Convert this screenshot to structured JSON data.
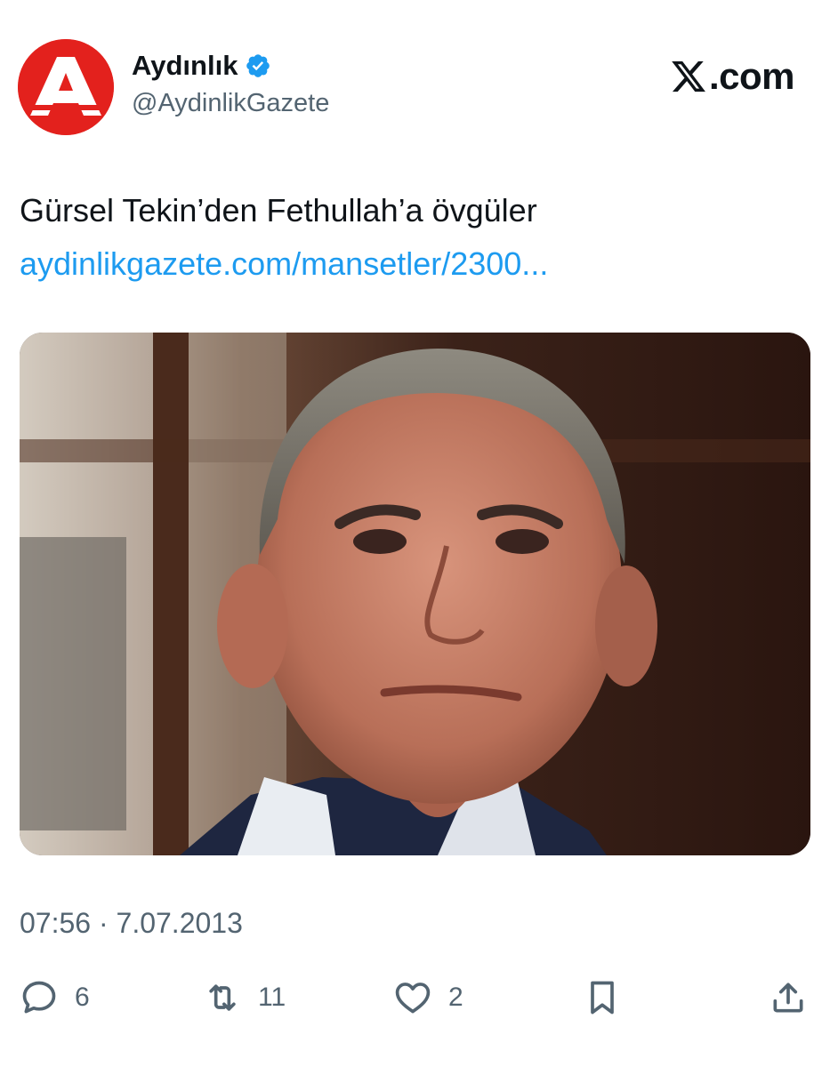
{
  "author": {
    "name": "Aydınlık",
    "handle": "@AydinlikGazete",
    "avatar_letter": "A",
    "avatar_color": "#e3211d",
    "verified": true,
    "verified_color": "#1d9bf0"
  },
  "source_label": ".com",
  "tweet": {
    "text": "Gürsel Tekin’den Fethullah’a övgüler",
    "link": "aydinlikgazete.com/mansetler/2300..."
  },
  "meta": {
    "timestamp": "07:56 · 7.07.2013"
  },
  "actions": {
    "replies": "6",
    "reposts": "11",
    "likes": "2"
  },
  "icons": {
    "reply": "reply-icon",
    "repost": "repost-icon",
    "like": "like-icon",
    "bookmark": "bookmark-icon",
    "share": "share-icon"
  },
  "colors": {
    "text": "#0f1419",
    "secondary": "#536471",
    "link": "#1d9bf0"
  }
}
